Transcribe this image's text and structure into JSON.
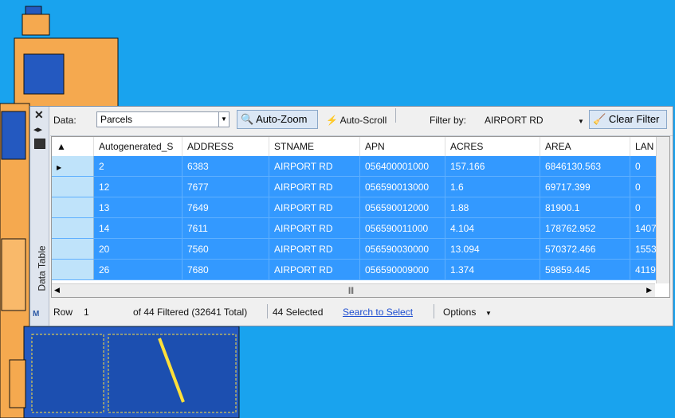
{
  "toolbar": {
    "data_label": "Data:",
    "data_value": "Parcels",
    "autozoom_label": "Auto-Zoom",
    "autoscroll_label": "Auto-Scroll",
    "filterby_label": "Filter by:",
    "filterby_value": "AIRPORT RD",
    "clear_filter_label": "Clear Filter",
    "help_label": "?"
  },
  "side": {
    "vertical_label": "Data Table"
  },
  "table": {
    "columns": [
      "Autogenerated_S",
      "ADDRESS",
      "STNAME",
      "APN",
      "ACRES",
      "AREA",
      "LAN"
    ],
    "rows": [
      [
        "2",
        "6383",
        "AIRPORT RD",
        "056400001000",
        "157.166",
        "6846130.563",
        "0"
      ],
      [
        "12",
        "7677",
        "AIRPORT RD",
        "056590013000",
        "1.6",
        "69717.399",
        "0"
      ],
      [
        "13",
        "7649",
        "AIRPORT RD",
        "056590012000",
        "1.88",
        "81900.1",
        "0"
      ],
      [
        "14",
        "7611",
        "AIRPORT RD",
        "056590011000",
        "4.104",
        "178762.952",
        "1407"
      ],
      [
        "20",
        "7560",
        "AIRPORT RD",
        "056590030000",
        "13.094",
        "570372.466",
        "1553"
      ],
      [
        "26",
        "7680",
        "AIRPORT RD",
        "056590009000",
        "1.374",
        "59859.445",
        "4119"
      ]
    ]
  },
  "status": {
    "row_label": "Row",
    "row_value": "1",
    "filtered_text": "of 44 Filtered (32641 Total)",
    "selected_text": "44 Selected",
    "search_to_select": "Search to Select",
    "options": "Options"
  },
  "colors": {
    "water": "#19a3ee",
    "parcel": "#f5a94f",
    "selection": "#3399ff",
    "parcel_blue": "#1c4fb0"
  }
}
